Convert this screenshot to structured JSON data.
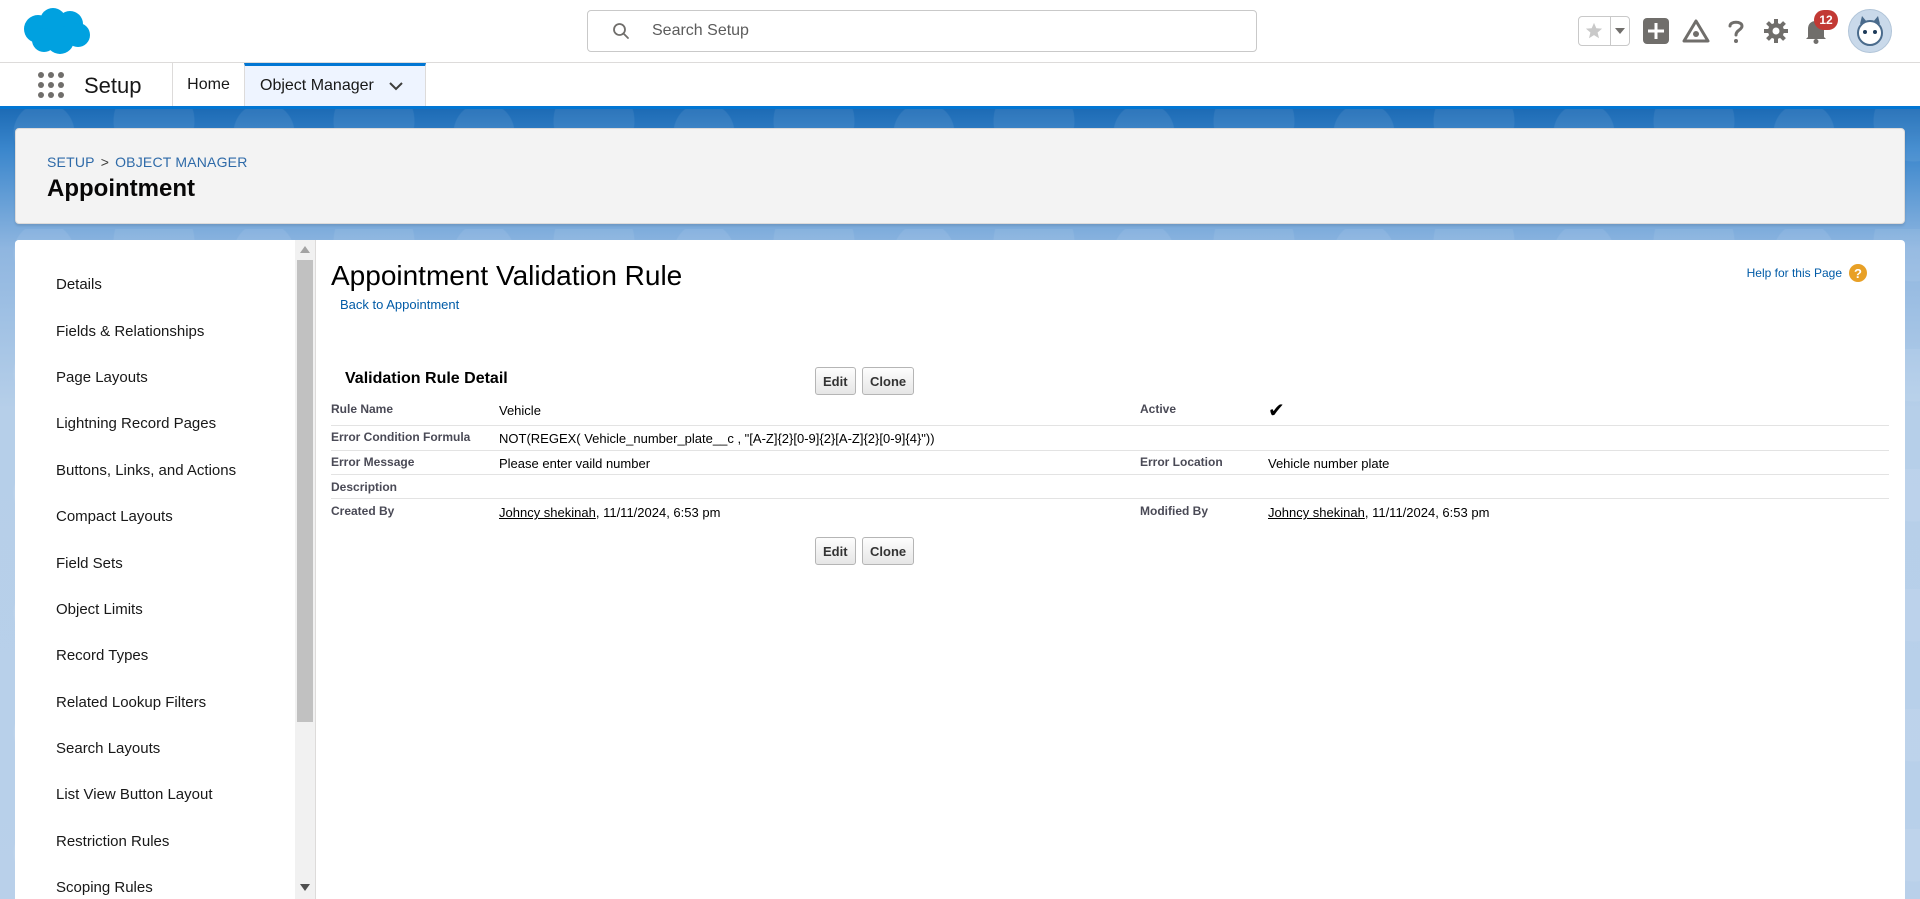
{
  "header": {
    "search_placeholder": "Search Setup",
    "notification_count": "12",
    "icons": [
      "salesforce-cloud-logo",
      "search-icon",
      "star-icon",
      "chevron-down-icon",
      "plus-icon",
      "trailhead-icon",
      "help-icon",
      "gear-icon",
      "bell-icon",
      "avatar"
    ]
  },
  "nav": {
    "app_name": "Setup",
    "tabs": [
      {
        "label": "Home"
      },
      {
        "label": "Object Manager"
      }
    ]
  },
  "page_header": {
    "breadcrumb": [
      "SETUP",
      "OBJECT MANAGER"
    ],
    "breadcrumb_sep": ">",
    "title": "Appointment"
  },
  "sidebar": {
    "items": [
      "Details",
      "Fields & Relationships",
      "Page Layouts",
      "Lightning Record Pages",
      "Buttons, Links, and Actions",
      "Compact Layouts",
      "Field Sets",
      "Object Limits",
      "Record Types",
      "Related Lookup Filters",
      "Search Layouts",
      "List View Button Layout",
      "Restriction Rules",
      "Scoping Rules"
    ]
  },
  "content": {
    "title": "Appointment Validation Rule",
    "back_link": "Back to Appointment",
    "help_link": "Help for this Page",
    "help_icon_glyph": "?",
    "section_title": "Validation Rule Detail",
    "edit_label": "Edit",
    "clone_label": "Clone",
    "fields": {
      "rule_name_label": "Rule Name",
      "rule_name": "Vehicle",
      "active_label": "Active",
      "active_check": "✔",
      "formula_label": "Error Condition Formula",
      "formula": "NOT(REGEX( Vehicle_number_plate__c , \"[A-Z]{2}[0-9]{2}[A-Z]{2}[0-9]{4}\"))",
      "message_label": "Error Message",
      "message": "Please enter vaild number",
      "location_label": "Error Location",
      "location": "Vehicle number plate",
      "description_label": "Description",
      "created_label": "Created By",
      "created_user": "Johncy shekinah",
      "created_date": ", 11/11/2024, 6:53 pm",
      "modified_label": "Modified By",
      "modified_user": "Johncy shekinah",
      "modified_date": ", 11/11/2024, 6:53 pm"
    }
  },
  "colors": {
    "brand_blue": "#0176d3",
    "link_blue": "#015ba7",
    "badge_red": "#c23934",
    "help_orange": "#e8a026"
  }
}
